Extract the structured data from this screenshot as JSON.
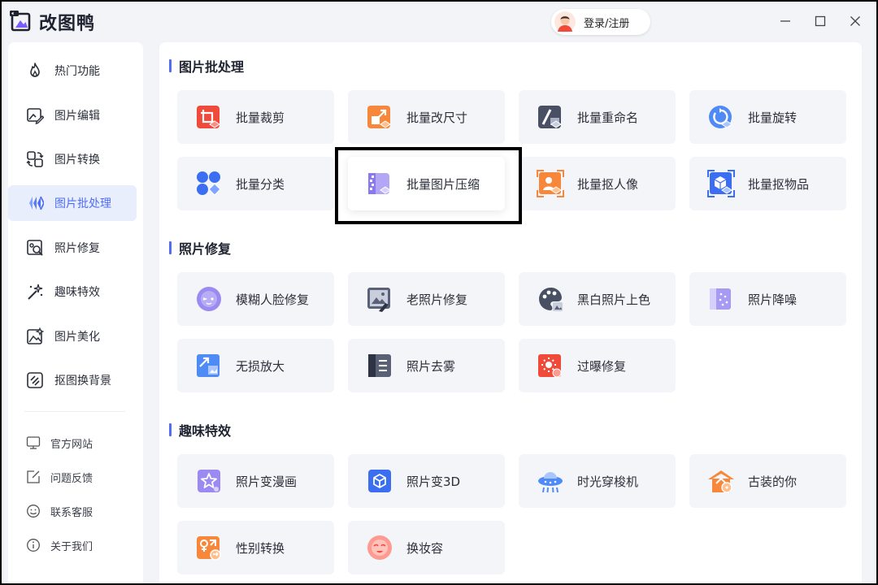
{
  "app": {
    "name": "改图鸭"
  },
  "header": {
    "login_label": "登录/注册"
  },
  "colors": {
    "accent": "#4f6ef5",
    "highlight_frame": "#000000"
  },
  "sidebar": {
    "items": [
      {
        "label": "热门功能",
        "icon": "flame-icon",
        "active": false
      },
      {
        "label": "图片编辑",
        "icon": "image-edit-icon",
        "active": false
      },
      {
        "label": "图片转换",
        "icon": "convert-icon",
        "active": false
      },
      {
        "label": "图片批处理",
        "icon": "batch-icon",
        "active": true
      },
      {
        "label": "照片修复",
        "icon": "photo-repair-icon",
        "active": false
      },
      {
        "label": "趣味特效",
        "icon": "magic-wand-icon",
        "active": false
      },
      {
        "label": "图片美化",
        "icon": "image-beautify-icon",
        "active": false
      },
      {
        "label": "抠图换背景",
        "icon": "cutout-icon",
        "active": false
      }
    ],
    "footer": [
      {
        "label": "官方网站",
        "icon": "monitor-icon"
      },
      {
        "label": "问题反馈",
        "icon": "edit-icon"
      },
      {
        "label": "联系客服",
        "icon": "smile-icon"
      },
      {
        "label": "关于我们",
        "icon": "info-icon"
      }
    ]
  },
  "sections": [
    {
      "title": "图片批处理",
      "cards": [
        {
          "label": "批量裁剪",
          "icon": "crop-icon"
        },
        {
          "label": "批量改尺寸",
          "icon": "resize-icon"
        },
        {
          "label": "批量重命名",
          "icon": "rename-icon"
        },
        {
          "label": "批量旋转",
          "icon": "rotate-icon"
        },
        {
          "label": "批量分类",
          "icon": "classify-icon"
        },
        {
          "label": "批量图片压缩",
          "icon": "compress-icon",
          "highlighted": true
        },
        {
          "label": "批量抠人像",
          "icon": "portrait-cutout-icon"
        },
        {
          "label": "批量抠物品",
          "icon": "object-cutout-icon"
        }
      ]
    },
    {
      "title": "照片修复",
      "cards": [
        {
          "label": "模糊人脸修复",
          "icon": "face-repair-icon"
        },
        {
          "label": "老照片修复",
          "icon": "old-photo-icon"
        },
        {
          "label": "黑白照片上色",
          "icon": "palette-icon"
        },
        {
          "label": "照片降噪",
          "icon": "denoise-icon"
        },
        {
          "label": "无损放大",
          "icon": "enlarge-icon"
        },
        {
          "label": "照片去雾",
          "icon": "dehaze-icon"
        },
        {
          "label": "过曝修复",
          "icon": "overexposure-icon"
        }
      ]
    },
    {
      "title": "趣味特效",
      "cards": [
        {
          "label": "照片变漫画",
          "icon": "cartoon-icon"
        },
        {
          "label": "照片变3D",
          "icon": "cube-3d-icon"
        },
        {
          "label": "时光穿梭机",
          "icon": "time-machine-icon"
        },
        {
          "label": "古装的你",
          "icon": "ancient-costume-icon"
        },
        {
          "label": "性别转换",
          "icon": "gender-swap-icon"
        },
        {
          "label": "换妆容",
          "icon": "makeup-icon"
        }
      ]
    }
  ]
}
